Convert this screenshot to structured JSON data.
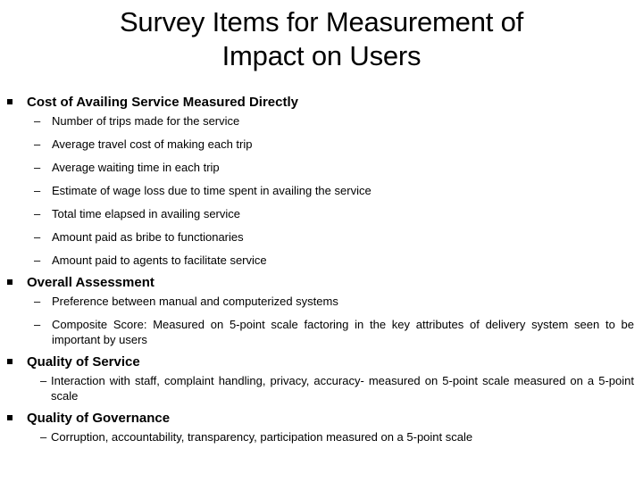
{
  "slide": {
    "title_line1": "Survey Items for Measurement of",
    "title_line2": "Impact on Users",
    "bullet_glyph": "square-bullet",
    "dash_glyph": "–",
    "text_color": "#000000",
    "background_color": "#ffffff"
  },
  "sections": [
    {
      "heading": "Cost of Availing Service Measured Directly",
      "items": [
        "Number of trips made for the service",
        "Average travel cost of making each trip",
        "Average waiting time in each trip",
        "Estimate of wage loss due to time spent in availing the service",
        "Total time elapsed in availing service",
        "Amount paid as bribe to functionaries",
        "Amount paid to agents to facilitate service"
      ]
    },
    {
      "heading": "Overall Assessment",
      "items": [
        "Preference between manual and computerized systems",
        "Composite Score: Measured on 5-point scale factoring in the key attributes of delivery system seen to be important by users"
      ]
    },
    {
      "heading": "Quality of Service",
      "items": [
        "Interaction with staff, complaint handling, privacy, accuracy- measured on 5-point scale measured on a 5-point scale"
      ]
    },
    {
      "heading": "Quality of Governance",
      "items": [
        "Corruption, accountability, transparency, participation measured on a 5-point scale"
      ]
    }
  ]
}
